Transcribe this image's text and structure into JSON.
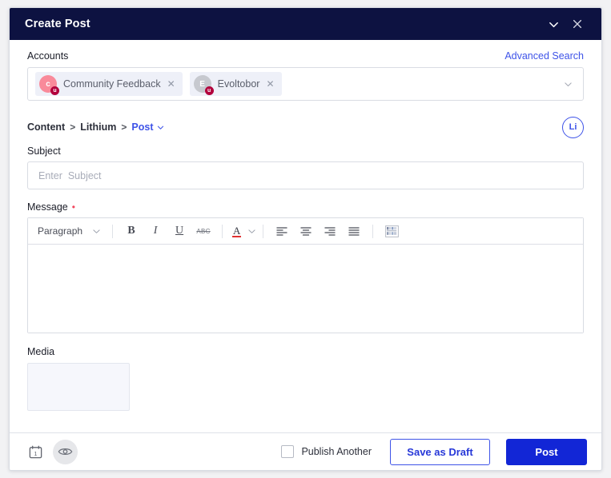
{
  "window": {
    "title": "Create Post",
    "collapse_icon": "chevron-down-icon",
    "close_icon": "close-icon"
  },
  "accounts": {
    "label": "Accounts",
    "advanced_search": "Advanced Search",
    "dropdown_icon": "chevron-down-icon",
    "chips": [
      {
        "name": "Community Feedback",
        "initial": "c",
        "avatar_color": "#f98a9a",
        "badge": "u",
        "badge_color": "#b2003c",
        "remove_icon": "close-icon"
      },
      {
        "name": "Evoltobor",
        "initial": "E",
        "avatar_color": "#c7c9cf",
        "badge": "u",
        "badge_color": "#b2003c",
        "remove_icon": "close-icon"
      }
    ]
  },
  "breadcrumb": {
    "items": [
      "Content",
      "Lithium",
      "Post"
    ],
    "separator": ">",
    "active": "Post",
    "active_caret_icon": "chevron-down-icon",
    "network_badge": "Li",
    "accent": "#3e53e8"
  },
  "subject": {
    "label": "Subject",
    "placeholder": "Enter  Subject",
    "value": ""
  },
  "message": {
    "label": "Message",
    "required_marker": "•",
    "required_color": "#f2465d",
    "value": "",
    "toolbar": {
      "block_format": "Paragraph",
      "block_caret_icon": "chevron-down-icon",
      "bold": "B",
      "italic": "I",
      "underline": "U",
      "strikethrough": "ABC",
      "text_color_letter": "A",
      "text_color_swatch": "#e03131",
      "text_color_caret_icon": "chevron-down-icon",
      "align_left": "align-left-icon",
      "align_center": "align-center-icon",
      "align_right": "align-right-icon",
      "align_justify": "align-justify-icon",
      "insert_media": "insert-media-grid-icon"
    }
  },
  "media": {
    "label": "Media"
  },
  "footer": {
    "schedule_icon": "calendar-icon",
    "calendar_day": "1",
    "preview_icon": "eye-icon",
    "publish_another_label": "Publish Another",
    "publish_another_checked": false,
    "save_draft_label": "Save as Draft",
    "post_label": "Post",
    "primary_color": "#1226d6"
  }
}
